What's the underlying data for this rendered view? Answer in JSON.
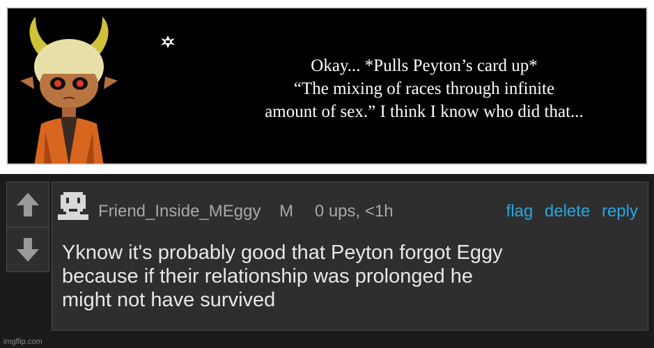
{
  "meme": {
    "dialogue_lines": [
      "Okay... *Pulls Peyton’s card up*",
      "“The mixing of races through infinite",
      "amount of sex.” I think I know who did that..."
    ]
  },
  "comment": {
    "username": "Friend_Inside_MEggy",
    "mod_badge": "M",
    "score": "0 ups, <1h",
    "actions": {
      "flag": "flag",
      "delete": "delete",
      "reply": "reply"
    },
    "text_lines": [
      "Yknow it's probably good that Peyton forgot Eggy",
      "because if their relationship was prolonged he",
      "might not have survived"
    ]
  },
  "icons": {
    "upvote": "arrow-up-icon",
    "downvote": "arrow-down-icon",
    "avatar": "pixel-avatar-icon",
    "star": "save-star-icon"
  },
  "colors": {
    "background": "#1b1b1b",
    "panel": "#2e2e2e",
    "link": "#26a8e0",
    "meta_text": "#a8a8a8"
  },
  "footer": {
    "watermark": "imgflip.com"
  }
}
